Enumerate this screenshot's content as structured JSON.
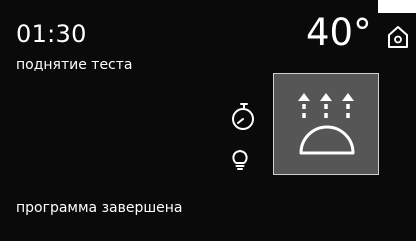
{
  "status_bar": {
    "timer": "01:30",
    "program_name": "поднятие теста",
    "temperature": "40°"
  },
  "icons": {
    "home": "home-icon",
    "stopwatch": "stopwatch-icon",
    "lamp": "lamp-icon",
    "mode": "proofing-mode-icon"
  },
  "footer": {
    "status_message": "программа завершена"
  },
  "colors": {
    "background": "#0a0a0a",
    "text": "#ffffff",
    "tile_fill": "#565656",
    "tile_border": "#cfcfcf"
  }
}
